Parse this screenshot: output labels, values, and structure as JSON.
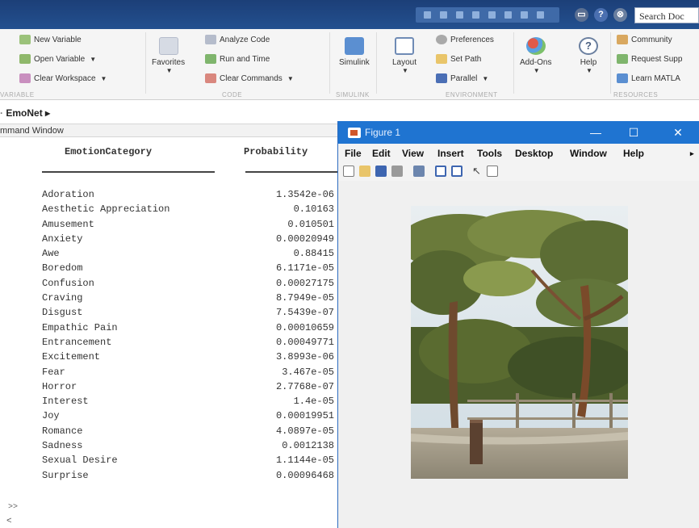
{
  "topbar": {
    "help_icon": "?",
    "search_text": "Search Doc",
    "colors": {
      "bar": "#23508f",
      "search_border": "#9aa8c0"
    }
  },
  "ribbon": {
    "variable": {
      "new_variable": "New Variable",
      "open_variable": "Open Variable",
      "clear_workspace": "Clear Workspace"
    },
    "favorites": "Favorites",
    "code": {
      "analyze_code": "Analyze Code",
      "run_and_time": "Run and Time",
      "clear_commands": "Clear Commands"
    },
    "simulink": "Simulink",
    "layout": "Layout",
    "environment": {
      "preferences": "Preferences",
      "set_path": "Set Path",
      "parallel": "Parallel"
    },
    "add_ons": "Add-Ons",
    "help": "Help",
    "resources": {
      "community": "Community",
      "request_support": "Request Supp",
      "learn_matlab": "Learn MATLA"
    },
    "group_labels": {
      "variable": "VARIABLE",
      "code": "CODE",
      "simulink": "SIMULINK",
      "environment": "ENVIRONMENT",
      "resources": "RESOURCES"
    }
  },
  "breadcrumb": {
    "path": "EmoNet",
    "arrow": "▸"
  },
  "command_window": {
    "title": "mmand Window",
    "headers": [
      "EmotionCategory",
      "Probability"
    ],
    "rows": [
      {
        "category": "Adoration",
        "probability": "1.3542e-06"
      },
      {
        "category": "Aesthetic Appreciation",
        "probability": "0.10163"
      },
      {
        "category": "Amusement",
        "probability": "0.010501"
      },
      {
        "category": "Anxiety",
        "probability": "0.00020949"
      },
      {
        "category": "Awe",
        "probability": "0.88415"
      },
      {
        "category": "Boredom",
        "probability": "6.1171e-05"
      },
      {
        "category": "Confusion",
        "probability": "0.00027175"
      },
      {
        "category": "Craving",
        "probability": "8.7949e-05"
      },
      {
        "category": "Disgust",
        "probability": "7.5439e-07"
      },
      {
        "category": "Empathic Pain",
        "probability": "0.00010659"
      },
      {
        "category": "Entrancement",
        "probability": "0.00049771"
      },
      {
        "category": "Excitement",
        "probability": "3.8993e-06"
      },
      {
        "category": "Fear",
        "probability": "3.467e-05"
      },
      {
        "category": "Horror",
        "probability": "2.7768e-07"
      },
      {
        "category": "Interest",
        "probability": "1.4e-05"
      },
      {
        "category": "Joy",
        "probability": "0.00019951"
      },
      {
        "category": "Romance",
        "probability": "4.0897e-05"
      },
      {
        "category": "Sadness",
        "probability": "0.0012138"
      },
      {
        "category": "Sexual Desire",
        "probability": "1.1144e-05"
      },
      {
        "category": "Surprise",
        "probability": "0.00096468"
      }
    ],
    "prompt": ">>",
    "scroll_left": "<"
  },
  "figure": {
    "title": "Figure 1",
    "minimize": "—",
    "maximize": "☐",
    "close": "✕",
    "menu": [
      "File",
      "Edit",
      "View",
      "Insert",
      "Tools",
      "Desktop",
      "Window",
      "Help"
    ],
    "menu_overflow": "▸",
    "colors": {
      "titlebar": "#1f74d1"
    }
  }
}
